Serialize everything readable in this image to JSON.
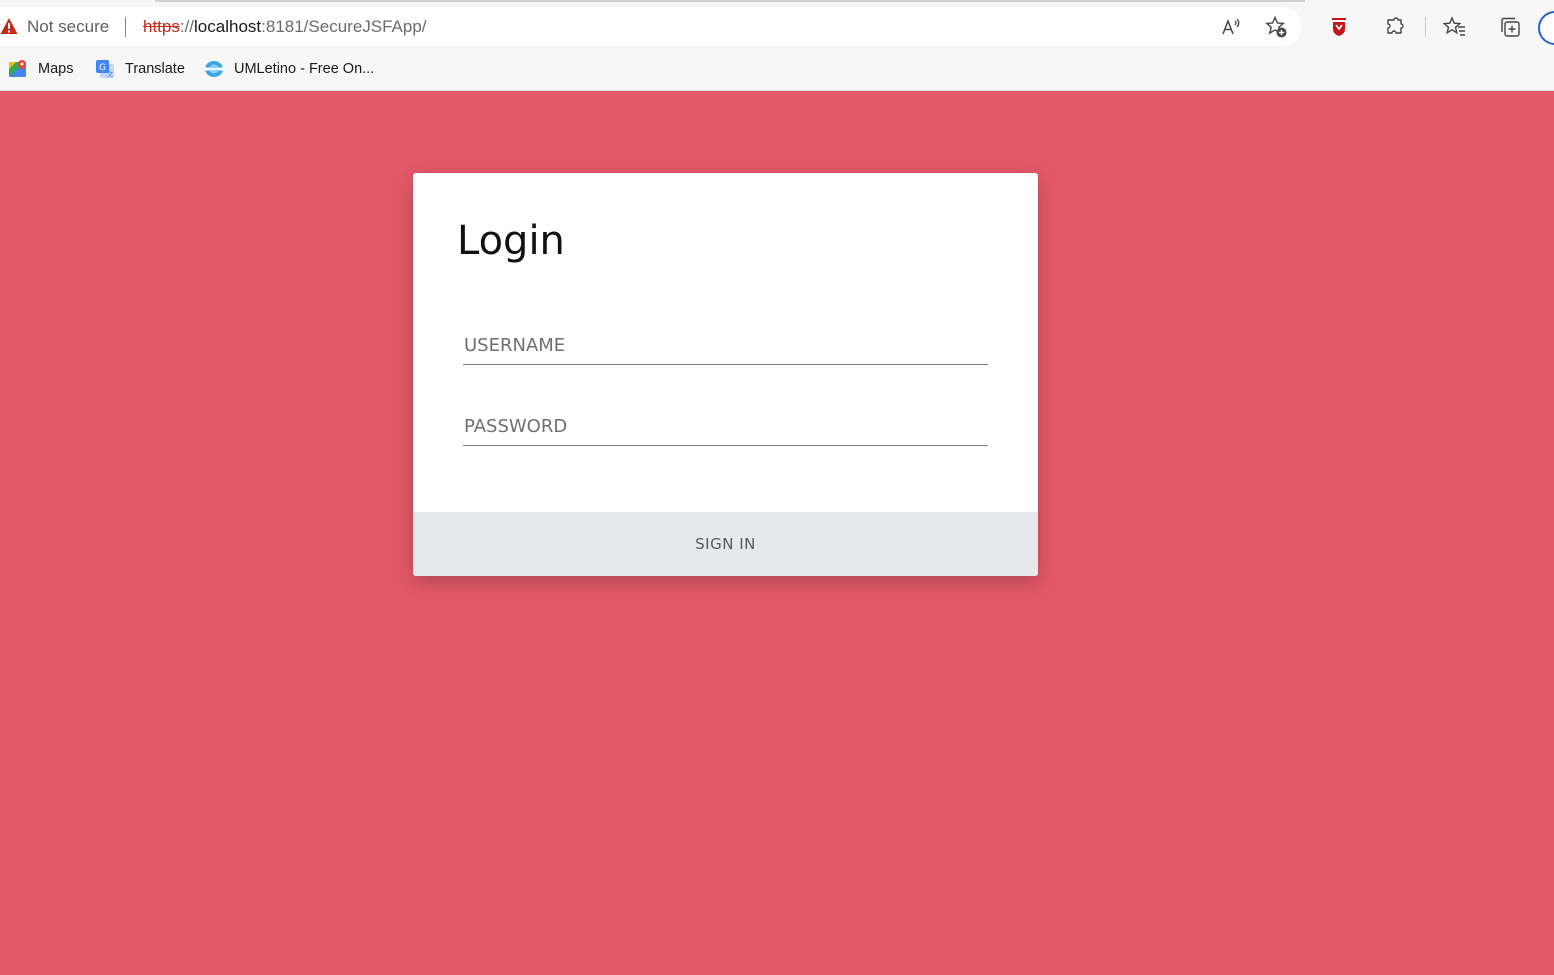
{
  "browser": {
    "security_label": "Not secure",
    "url": {
      "scheme": "https",
      "separator": "://",
      "host": "localhost",
      "port_path": ":8181/SecureJSFApp/"
    },
    "toolbar_icons": [
      "read-aloud-icon",
      "add-favorite-icon",
      "mcafee-extension-icon",
      "extensions-icon",
      "favorites-icon",
      "collections-icon",
      "profile-icon"
    ],
    "bookmarks": [
      {
        "label": "Maps",
        "icon": "maps-icon"
      },
      {
        "label": "Translate",
        "icon": "translate-icon"
      },
      {
        "label": "UMLetino - Free On...",
        "icon": "umletino-icon"
      }
    ]
  },
  "page": {
    "background_color": "#e25969",
    "login": {
      "title": "Login",
      "username_placeholder": "USERNAME",
      "password_placeholder": "PASSWORD",
      "submit_label": "SIGN IN"
    }
  }
}
